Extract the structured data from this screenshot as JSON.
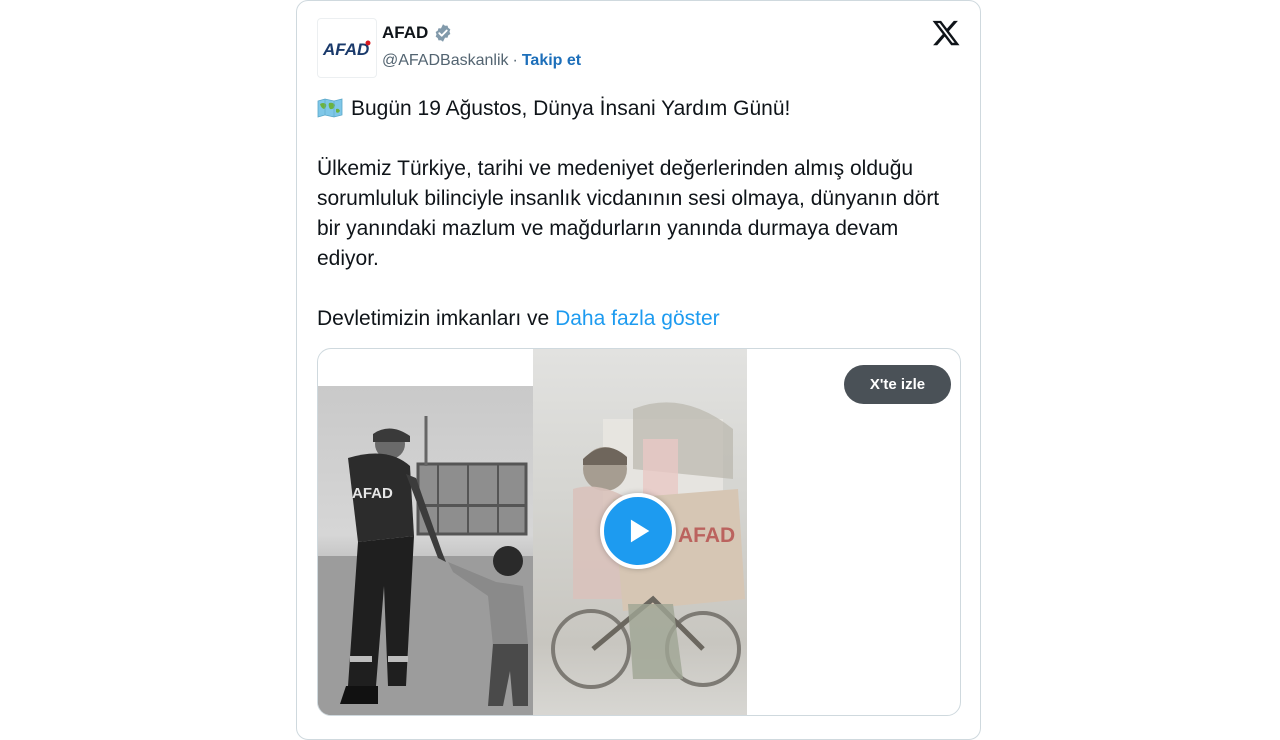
{
  "account": {
    "avatar_text": "AFAD",
    "name": "AFAD",
    "handle": "@AFADBaskanlik",
    "separator": "·",
    "follow_label": "Takip et"
  },
  "tweet": {
    "line1": "Bugün 19 Ağustos, Dünya İnsani Yardım Günü!",
    "paragraph2": "Ülkemiz Türkiye, tarihi ve medeniyet değerlerinden almış olduğu sorumluluk bilinciyle insanlık vicdanının sesi olmaya, dünyanın dört bir yanındaki mazlum ve mağdurların yanında durmaya devam ediyor.",
    "paragraph3": "Devletimizin imkanları ve",
    "show_more": "Daha fazla göster"
  },
  "media": {
    "watch_label": "X'te izle",
    "vest_text": "AFAD",
    "box_text": "AFAD"
  },
  "colors": {
    "link": "#1d9bf0",
    "follow": "#1d6fba",
    "text": "#0f1419",
    "muted": "#536471",
    "verified": "#829aab",
    "brand_red": "#d7191f",
    "brand_blue": "#1a3a6b"
  },
  "icons": {
    "verified": "verified-badge-icon",
    "x_logo": "x-logo-icon",
    "map": "world-map-emoji-icon",
    "play": "play-icon"
  }
}
